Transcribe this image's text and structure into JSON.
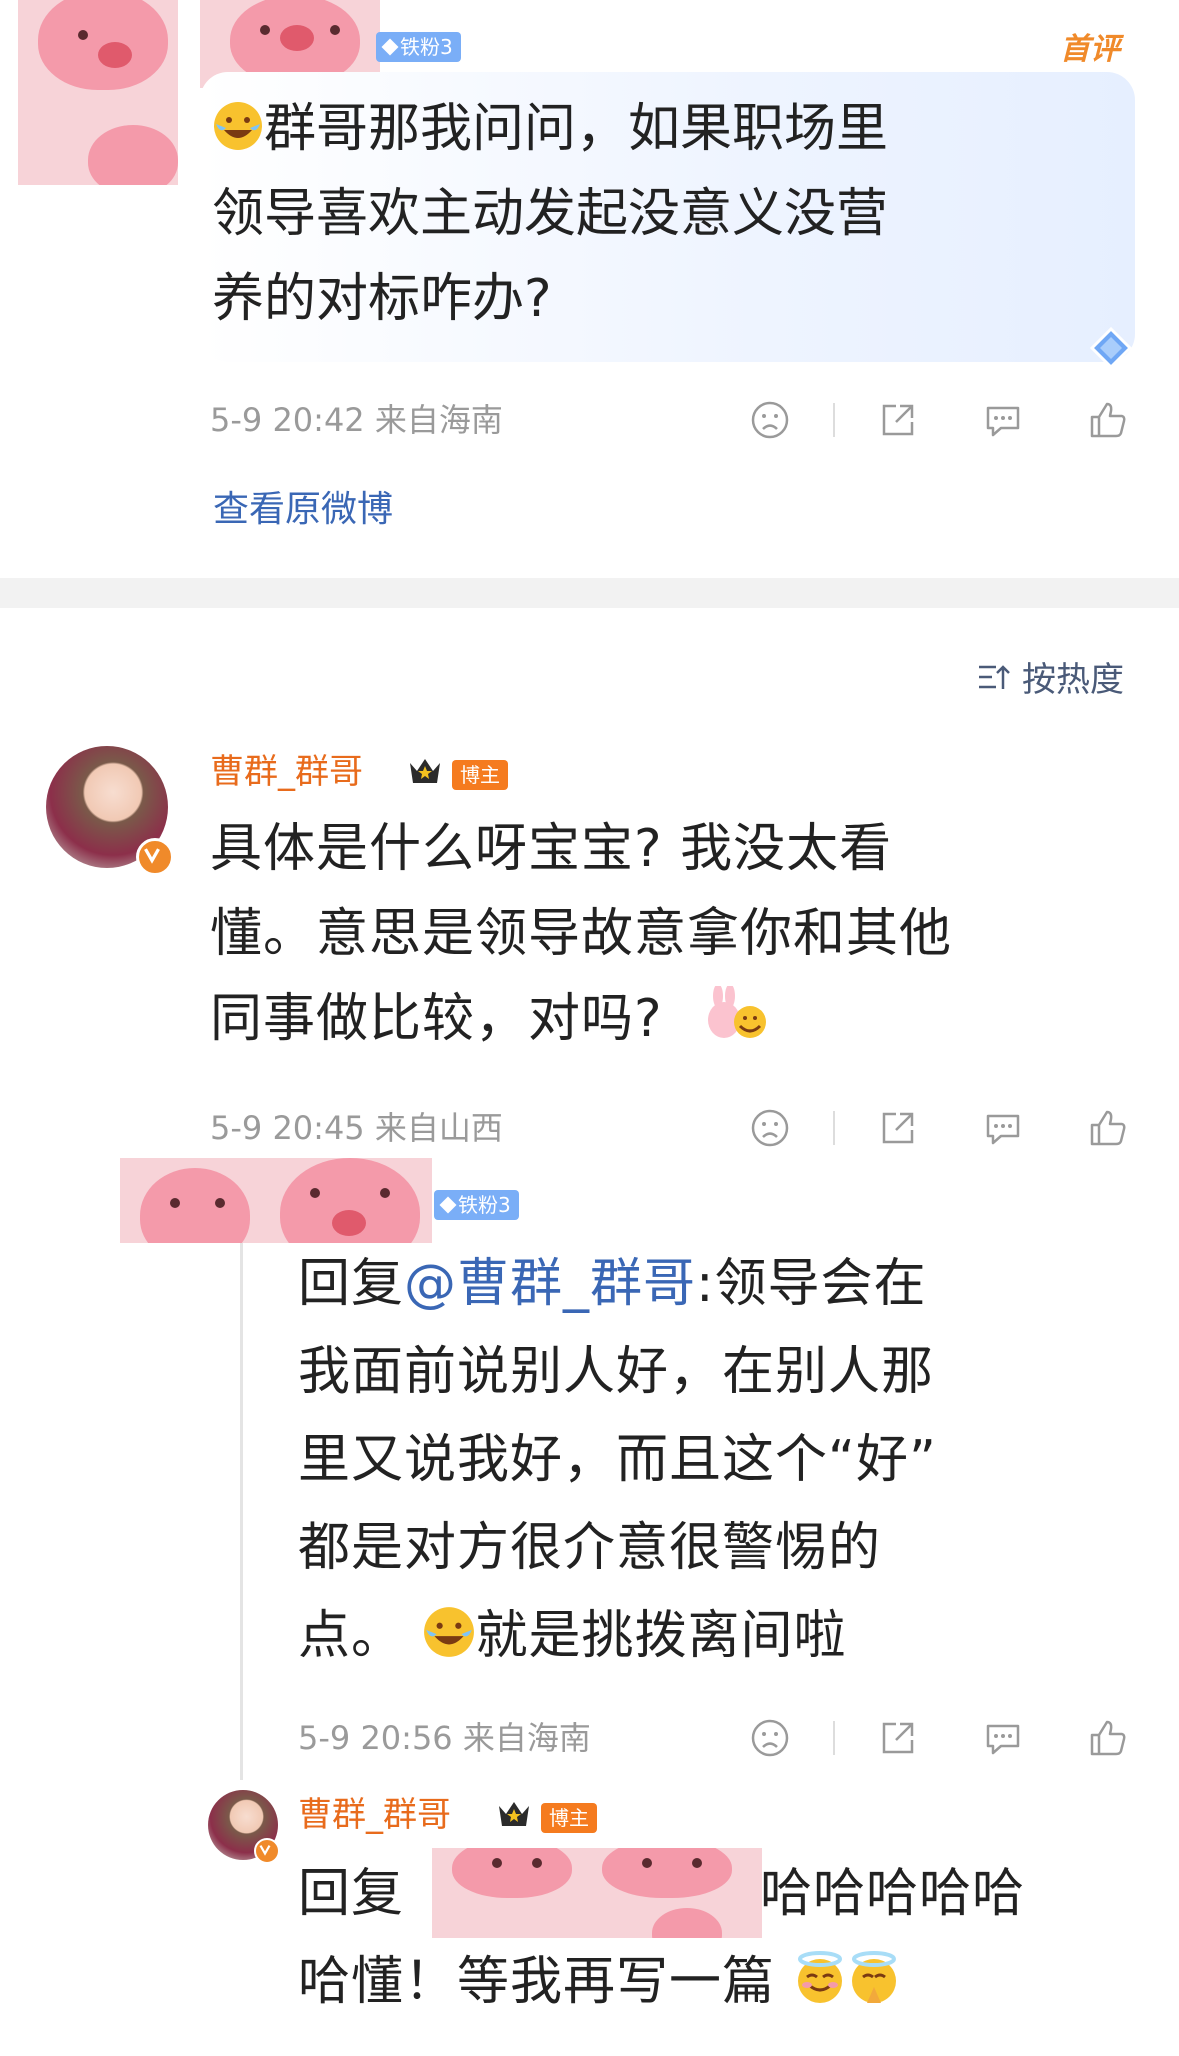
{
  "top_comment": {
    "fan_badge": "铁粉3",
    "first_label": "首评",
    "text": "群哥那我问问，如果职场里领导喜欢主动发起没意义没营养的对标咋办?",
    "line1": "群哥那我问问，如果职场里",
    "line2": "领导喜欢主动发起没意义没营",
    "line3": "养的对标咋办?",
    "meta": "5-9 20:42 来自海南",
    "view_original": "查看原微博"
  },
  "sort": {
    "label": "按热度",
    "icon": "sort-icon"
  },
  "reply1": {
    "username": "曹群_群哥",
    "role_badge": "博主",
    "line1": "具体是什么呀宝宝? 我没太看",
    "line2": "懂。意思是领导故意拿你和其他",
    "line3": "同事做比较，对吗?",
    "meta": "5-9 20:45 来自山西"
  },
  "reply2": {
    "fan_badge": "铁粉3",
    "prefix": "回复",
    "mention": "@曹群_群哥",
    "line1_rest": ":领导会在",
    "line2": "我面前说别人好，在别人那",
    "line3": "里又说我好，而且这个“好”",
    "line4": "都是对方很介意很警惕的",
    "line5_a": "点。",
    "line5_b": "就是挑拨离间啦",
    "meta": "5-9 20:56 来自海南"
  },
  "reply3": {
    "username": "曹群_群哥",
    "role_badge": "博主",
    "prefix": "回复",
    "line1_rest": "哈哈哈哈哈",
    "line2": "哈懂！等我再写一篇"
  },
  "colors": {
    "username": "#e86b1c",
    "link": "#3a67b5",
    "meta": "#9a9a9a",
    "fan_badge": "#7aaef7",
    "boss_badge": "#f57b1f"
  }
}
